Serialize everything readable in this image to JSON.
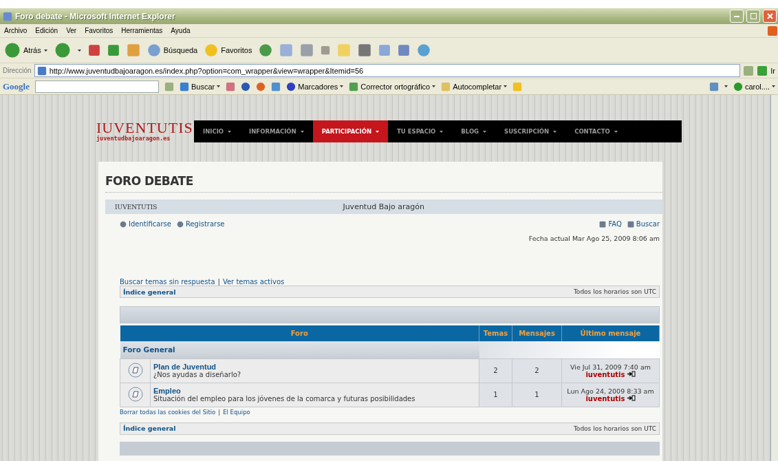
{
  "window": {
    "title": "Foro debate - Microsoft Internet Explorer"
  },
  "menu_bar": [
    "Archivo",
    "Edición",
    "Ver",
    "Favoritos",
    "Herramientas",
    "Ayuda"
  ],
  "toolbar": {
    "back": "Atrás",
    "search": "Búsqueda",
    "favorites": "Favoritos"
  },
  "address_bar": {
    "label": "Dirección",
    "url": "http://www.juventudbajoaragon.es/index.php?option=com_wrapper&view=wrapper&Itemid=56",
    "go": "Ir"
  },
  "google_bar": {
    "logo": "Google",
    "search": "Buscar",
    "bookmarks": "Marcadores",
    "spellcheck": "Corrector ortográfico",
    "autofill": "Autocompletar",
    "user": "carol...."
  },
  "site": {
    "logo": "IUVENTUTIS",
    "domain": "juventudbajoaragon.es",
    "nav": [
      {
        "label": "INICIO",
        "selected": false
      },
      {
        "label": "INFORMACIÓN",
        "selected": false
      },
      {
        "label": "PARTICIPACIÓN",
        "selected": true
      },
      {
        "label": "TU ESPACIO",
        "selected": false
      },
      {
        "label": "BLOG",
        "selected": false
      },
      {
        "label": "SUSCRIPCIÓN",
        "selected": false
      },
      {
        "label": "CONTACTO",
        "selected": false
      }
    ],
    "page_title": "FORO DEBATE"
  },
  "forum": {
    "header_left": "IUVENTUTIS",
    "header_center": "Juventud Bajo aragón",
    "user_links": [
      "Identificarse",
      "Registrarse"
    ],
    "help_links": [
      "FAQ",
      "Buscar"
    ],
    "current_date": "Fecha actual Mar Ago 25, 2009 8:06 am",
    "quick_links": [
      "Buscar temas sin respuesta",
      "Ver temas activos"
    ],
    "quick_links_separator": "|",
    "footer_links_separator": "|",
    "breadcrumb": {
      "link": "Índice general",
      "timezone": "Todos los horarios son UTC"
    },
    "columns": [
      "Foro",
      "Temas",
      "Mensajes",
      "Último mensaje"
    ],
    "category": "Foro General",
    "rows": [
      {
        "title": "Plan de Juventud",
        "description": "¿Nos ayudas a diseñarlo?",
        "topics": "2",
        "posts": "2",
        "last_date": "Vie Jul 31, 2009 7:40 am",
        "last_user": "iuventutis"
      },
      {
        "title": "Empleo",
        "description": "Situación del empleo para los jóvenes de la comarca y futuras posibilidades",
        "topics": "1",
        "posts": "1",
        "last_date": "Lun Ago 24, 2009 8:33 am",
        "last_user": "iuventutis"
      }
    ],
    "footer_links": [
      "Borrar todas las cookies del Sitio",
      "El Equipo"
    ],
    "breadcrumb_bottom": {
      "link": "Índice general",
      "timezone": "Todos los horarios son UTC"
    }
  }
}
